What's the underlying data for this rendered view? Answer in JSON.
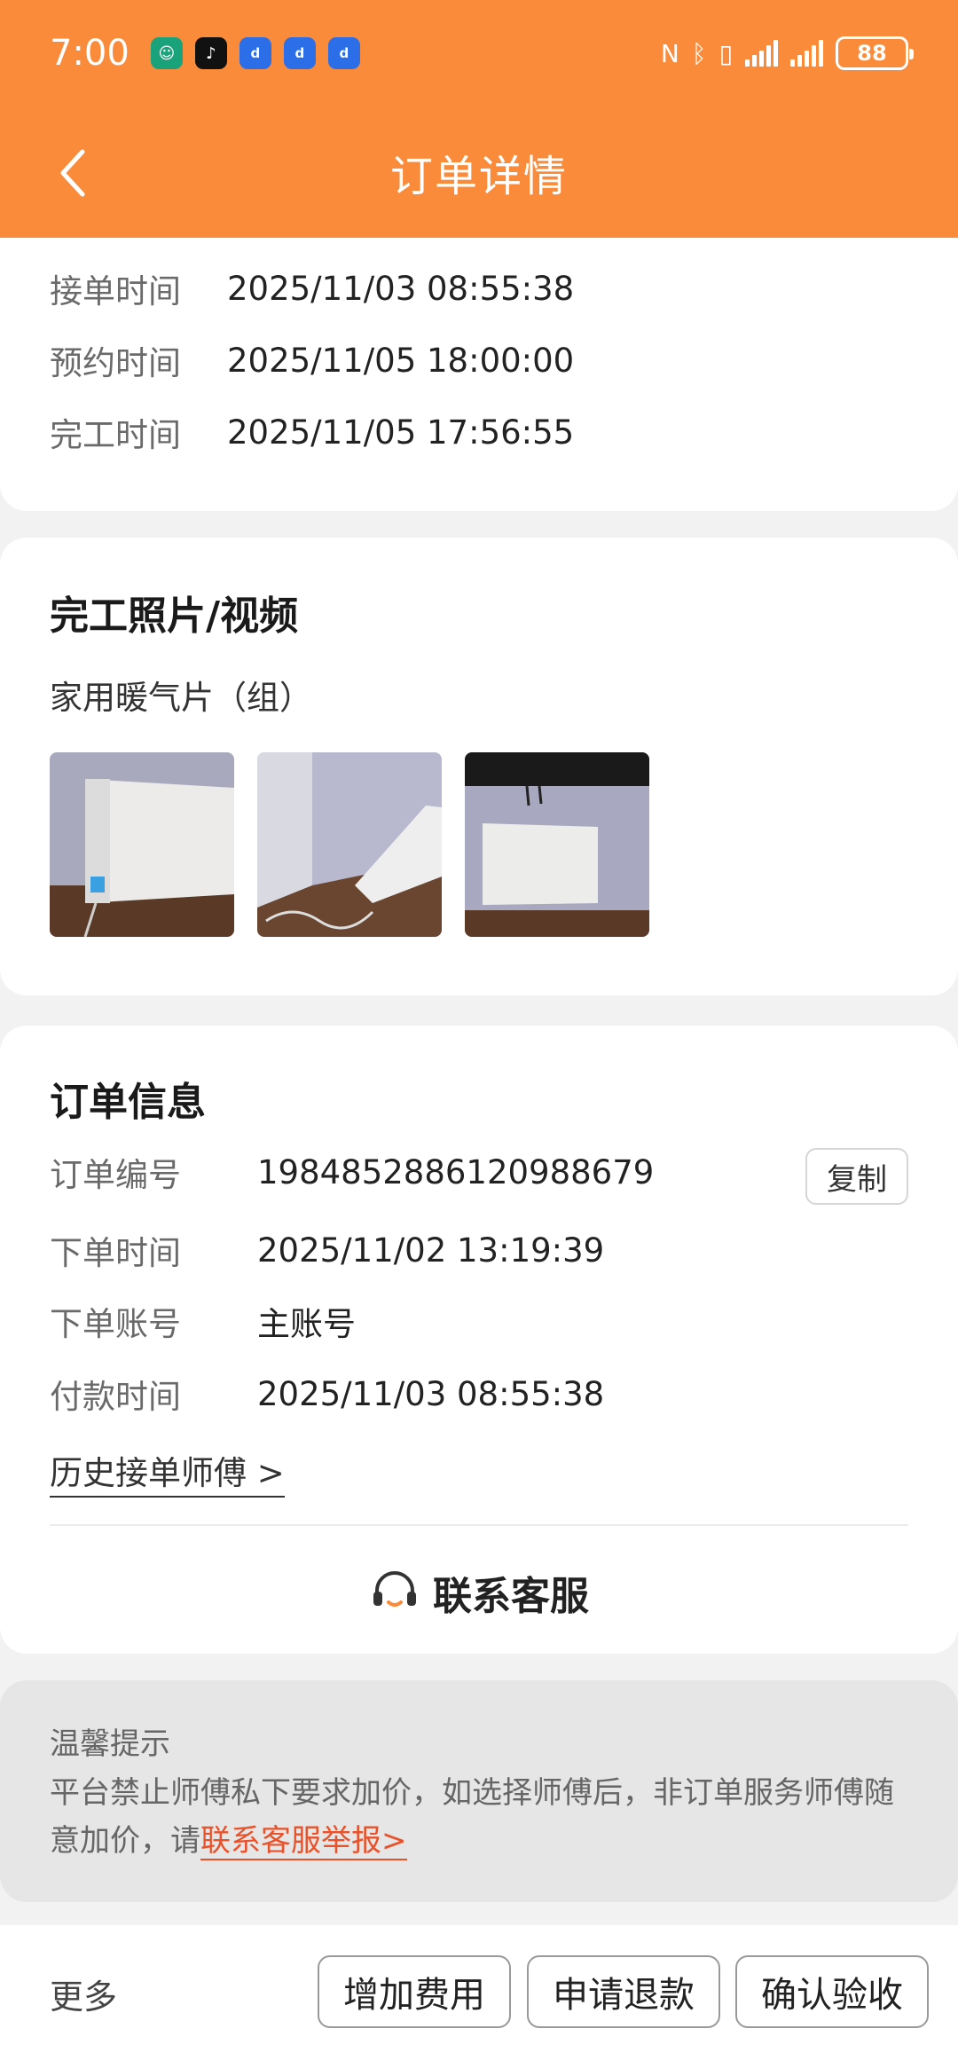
{
  "status_bar": {
    "time": "7:00",
    "battery": "88",
    "apps": [
      "app-green",
      "tiktok",
      "app-blue",
      "app-blue",
      "app-blue"
    ]
  },
  "header": {
    "title": "订单详情",
    "bg_color": "#f98b3a"
  },
  "timeline": {
    "rows": [
      {
        "label": "接单时间",
        "value": "2025/11/03 08:55:38"
      },
      {
        "label": "预约时间",
        "value": "2025/11/05 18:00:00"
      },
      {
        "label": "完工时间",
        "value": "2025/11/05 17:56:55"
      }
    ]
  },
  "completion": {
    "title": "完工照片/视频",
    "item": "家用暖气片（组）"
  },
  "order_info": {
    "title": "订单信息",
    "rows": [
      {
        "label": "订单编号",
        "value": "1984852886120988679"
      },
      {
        "label": "下单时间",
        "value": "2025/11/02 13:19:39"
      },
      {
        "label": "下单账号",
        "value": "主账号"
      },
      {
        "label": "付款时间",
        "value": "2025/11/03 08:55:38"
      }
    ],
    "copy_label": "复制",
    "history_link": "历史接单师傅 >",
    "contact_label": "联系客服"
  },
  "tips": {
    "title": "温馨提示",
    "body": "平台禁止师傅私下要求加价，如选择师傅后，非订单服务师傅随意加价，请",
    "link": "联系客服举报>",
    "link_color": "#e8512a"
  },
  "bottom_bar": {
    "more": "更多",
    "buttons": [
      "增加费用",
      "申请退款",
      "确认验收"
    ]
  }
}
